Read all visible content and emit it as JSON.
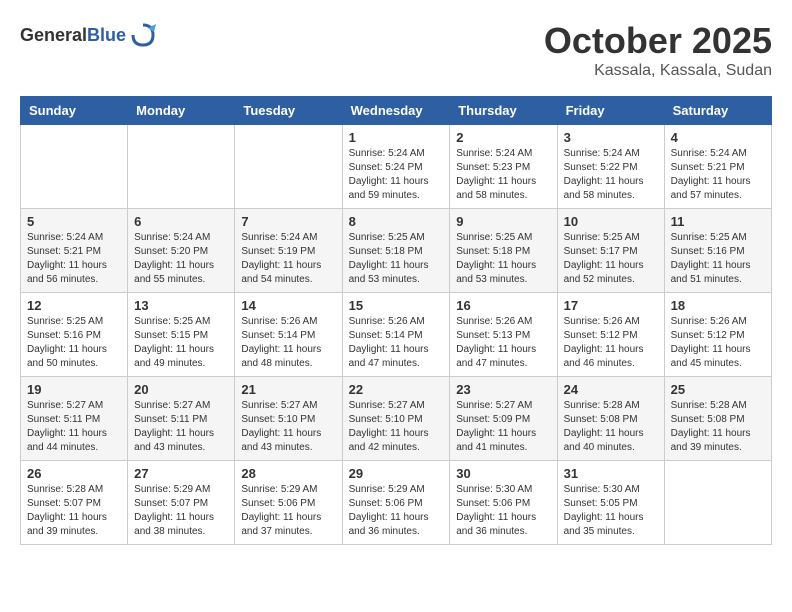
{
  "header": {
    "logo_general": "General",
    "logo_blue": "Blue",
    "month": "October 2025",
    "location": "Kassala, Kassala, Sudan"
  },
  "weekdays": [
    "Sunday",
    "Monday",
    "Tuesday",
    "Wednesday",
    "Thursday",
    "Friday",
    "Saturday"
  ],
  "weeks": [
    [
      {
        "day": "",
        "info": ""
      },
      {
        "day": "",
        "info": ""
      },
      {
        "day": "",
        "info": ""
      },
      {
        "day": "1",
        "info": "Sunrise: 5:24 AM\nSunset: 5:24 PM\nDaylight: 11 hours\nand 59 minutes."
      },
      {
        "day": "2",
        "info": "Sunrise: 5:24 AM\nSunset: 5:23 PM\nDaylight: 11 hours\nand 58 minutes."
      },
      {
        "day": "3",
        "info": "Sunrise: 5:24 AM\nSunset: 5:22 PM\nDaylight: 11 hours\nand 58 minutes."
      },
      {
        "day": "4",
        "info": "Sunrise: 5:24 AM\nSunset: 5:21 PM\nDaylight: 11 hours\nand 57 minutes."
      }
    ],
    [
      {
        "day": "5",
        "info": "Sunrise: 5:24 AM\nSunset: 5:21 PM\nDaylight: 11 hours\nand 56 minutes."
      },
      {
        "day": "6",
        "info": "Sunrise: 5:24 AM\nSunset: 5:20 PM\nDaylight: 11 hours\nand 55 minutes."
      },
      {
        "day": "7",
        "info": "Sunrise: 5:24 AM\nSunset: 5:19 PM\nDaylight: 11 hours\nand 54 minutes."
      },
      {
        "day": "8",
        "info": "Sunrise: 5:25 AM\nSunset: 5:18 PM\nDaylight: 11 hours\nand 53 minutes."
      },
      {
        "day": "9",
        "info": "Sunrise: 5:25 AM\nSunset: 5:18 PM\nDaylight: 11 hours\nand 53 minutes."
      },
      {
        "day": "10",
        "info": "Sunrise: 5:25 AM\nSunset: 5:17 PM\nDaylight: 11 hours\nand 52 minutes."
      },
      {
        "day": "11",
        "info": "Sunrise: 5:25 AM\nSunset: 5:16 PM\nDaylight: 11 hours\nand 51 minutes."
      }
    ],
    [
      {
        "day": "12",
        "info": "Sunrise: 5:25 AM\nSunset: 5:16 PM\nDaylight: 11 hours\nand 50 minutes."
      },
      {
        "day": "13",
        "info": "Sunrise: 5:25 AM\nSunset: 5:15 PM\nDaylight: 11 hours\nand 49 minutes."
      },
      {
        "day": "14",
        "info": "Sunrise: 5:26 AM\nSunset: 5:14 PM\nDaylight: 11 hours\nand 48 minutes."
      },
      {
        "day": "15",
        "info": "Sunrise: 5:26 AM\nSunset: 5:14 PM\nDaylight: 11 hours\nand 47 minutes."
      },
      {
        "day": "16",
        "info": "Sunrise: 5:26 AM\nSunset: 5:13 PM\nDaylight: 11 hours\nand 47 minutes."
      },
      {
        "day": "17",
        "info": "Sunrise: 5:26 AM\nSunset: 5:12 PM\nDaylight: 11 hours\nand 46 minutes."
      },
      {
        "day": "18",
        "info": "Sunrise: 5:26 AM\nSunset: 5:12 PM\nDaylight: 11 hours\nand 45 minutes."
      }
    ],
    [
      {
        "day": "19",
        "info": "Sunrise: 5:27 AM\nSunset: 5:11 PM\nDaylight: 11 hours\nand 44 minutes."
      },
      {
        "day": "20",
        "info": "Sunrise: 5:27 AM\nSunset: 5:11 PM\nDaylight: 11 hours\nand 43 minutes."
      },
      {
        "day": "21",
        "info": "Sunrise: 5:27 AM\nSunset: 5:10 PM\nDaylight: 11 hours\nand 43 minutes."
      },
      {
        "day": "22",
        "info": "Sunrise: 5:27 AM\nSunset: 5:10 PM\nDaylight: 11 hours\nand 42 minutes."
      },
      {
        "day": "23",
        "info": "Sunrise: 5:27 AM\nSunset: 5:09 PM\nDaylight: 11 hours\nand 41 minutes."
      },
      {
        "day": "24",
        "info": "Sunrise: 5:28 AM\nSunset: 5:08 PM\nDaylight: 11 hours\nand 40 minutes."
      },
      {
        "day": "25",
        "info": "Sunrise: 5:28 AM\nSunset: 5:08 PM\nDaylight: 11 hours\nand 39 minutes."
      }
    ],
    [
      {
        "day": "26",
        "info": "Sunrise: 5:28 AM\nSunset: 5:07 PM\nDaylight: 11 hours\nand 39 minutes."
      },
      {
        "day": "27",
        "info": "Sunrise: 5:29 AM\nSunset: 5:07 PM\nDaylight: 11 hours\nand 38 minutes."
      },
      {
        "day": "28",
        "info": "Sunrise: 5:29 AM\nSunset: 5:06 PM\nDaylight: 11 hours\nand 37 minutes."
      },
      {
        "day": "29",
        "info": "Sunrise: 5:29 AM\nSunset: 5:06 PM\nDaylight: 11 hours\nand 36 minutes."
      },
      {
        "day": "30",
        "info": "Sunrise: 5:30 AM\nSunset: 5:06 PM\nDaylight: 11 hours\nand 36 minutes."
      },
      {
        "day": "31",
        "info": "Sunrise: 5:30 AM\nSunset: 5:05 PM\nDaylight: 11 hours\nand 35 minutes."
      },
      {
        "day": "",
        "info": ""
      }
    ]
  ]
}
